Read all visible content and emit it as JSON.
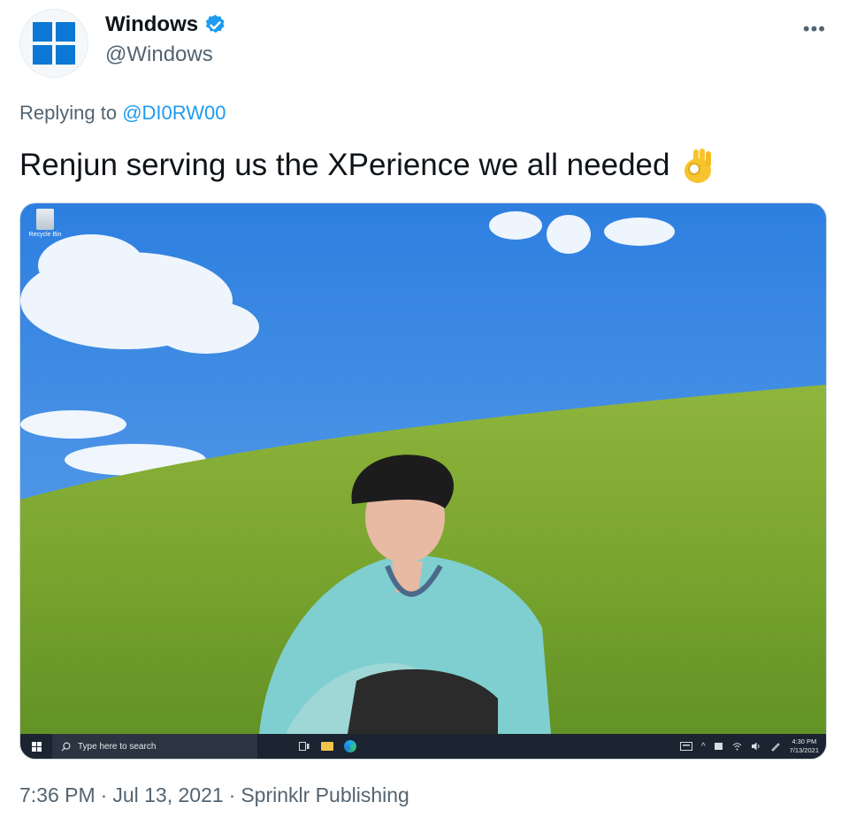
{
  "author": {
    "display_name": "Windows",
    "handle": "@Windows",
    "icons": {
      "avatar": "windows-logo",
      "verified": "verified-badge-icon"
    },
    "colors": {
      "logo": "#0a78d4",
      "verified": "#1d9bf0"
    }
  },
  "menu": {
    "more_label": "•••"
  },
  "reply": {
    "prefix": "Replying to ",
    "mention": "@DI0RW00"
  },
  "tweet": {
    "text": "Renjun serving us the XPerience we all needed",
    "emoji": "ok-hand-emoji"
  },
  "media": {
    "desktop": {
      "recycle_bin_label": "Recycle Bin"
    },
    "taskbar": {
      "search_placeholder": "Type here to search",
      "time": "4:30 PM",
      "date": "7/13/2021",
      "tray_caret": "^"
    }
  },
  "meta": {
    "time": "7:36 PM",
    "date": "Jul 13, 2021",
    "source": "Sprinklr Publishing",
    "separator": "·"
  }
}
